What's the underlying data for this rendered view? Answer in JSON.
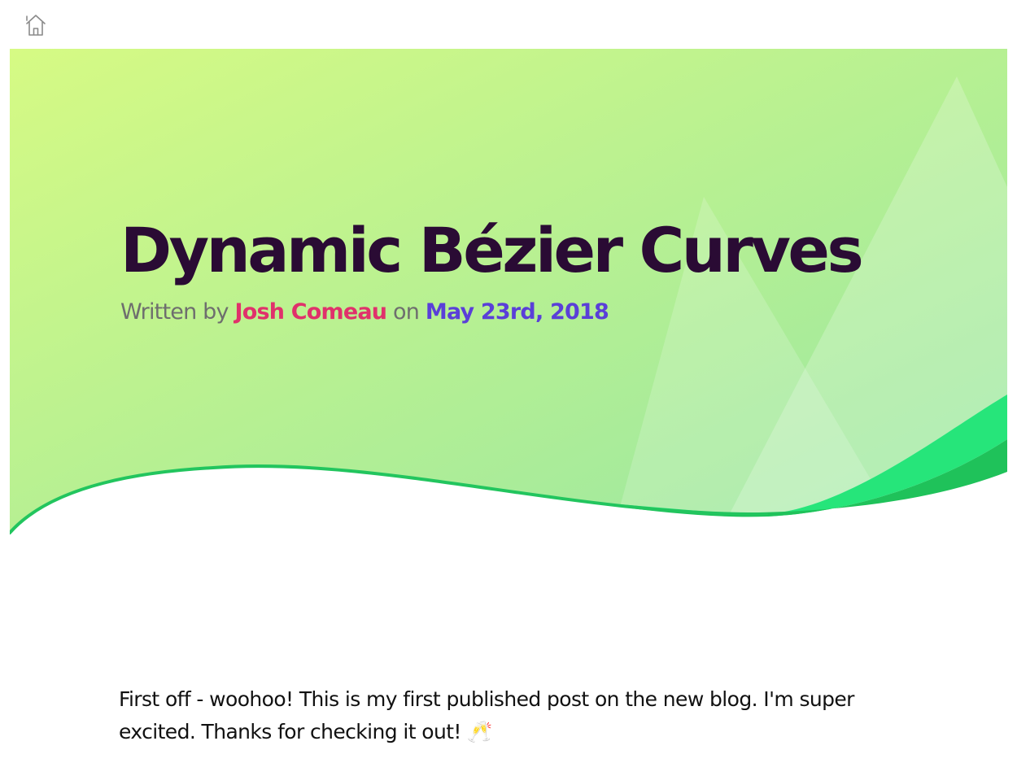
{
  "nav": {
    "home_label": "Home"
  },
  "post": {
    "title": "Dynamic Bézier Curves",
    "byline_prefix": "Written by",
    "author": "Josh Comeau",
    "byline_middle": "on",
    "date": "May 23rd, 2018"
  },
  "body": {
    "intro_text": "First off - woohoo! This is my first published post on the new blog. I'm super excited. Thanks for checking it out!",
    "intro_emoji": "🥂"
  },
  "colors": {
    "title": "#2a0b34",
    "author": "#e0316b",
    "date": "#5a3fd8",
    "hero_gradient_start": "#d4f984",
    "hero_gradient_end": "#a0e9a0",
    "wave_green": "#22c55e"
  },
  "icons": {
    "home": "home-icon",
    "celebration": "clinking-glasses-emoji"
  }
}
